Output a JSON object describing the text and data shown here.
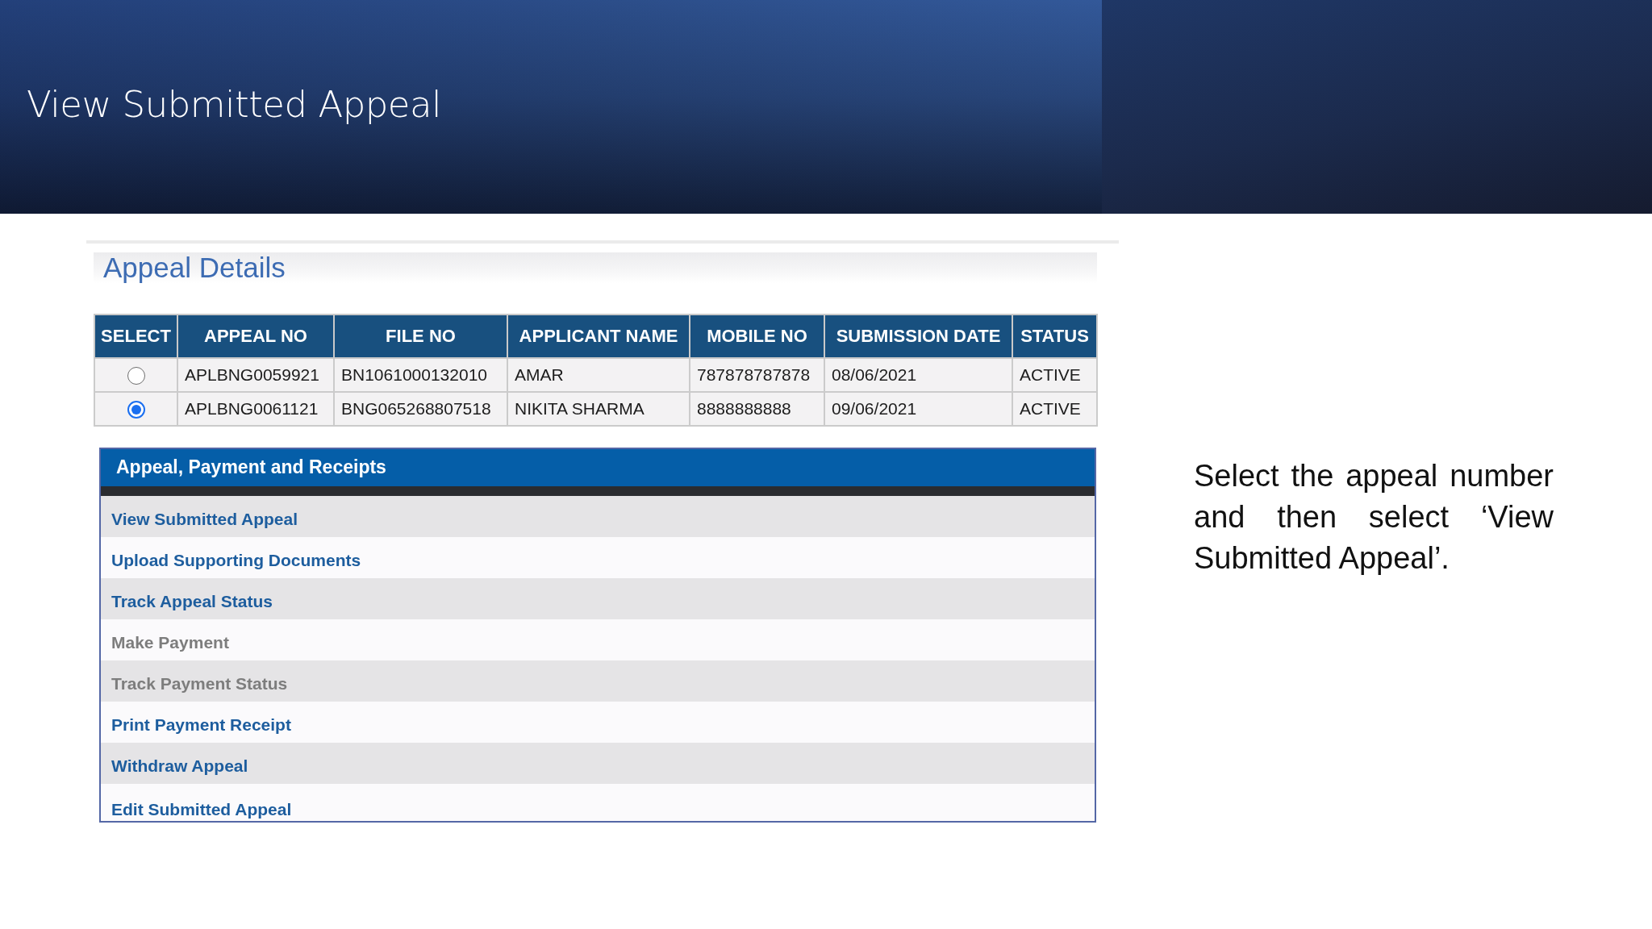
{
  "slide": {
    "title": "View Submitted Appeal",
    "note": "Select the appeal number and then select ‘View Submitted Appeal’."
  },
  "appeal_details": {
    "title": "Appeal Details",
    "table": {
      "columns": [
        "SELECT",
        "APPEAL NO",
        "FILE NO",
        "APPLICANT NAME",
        "MOBILE NO",
        "SUBMISSION DATE",
        "STATUS"
      ],
      "rows": [
        {
          "selected": false,
          "cells": [
            "",
            "APLBNG0059921",
            "BN1061000132010",
            "AMAR",
            "787878787878",
            "08/06/2021",
            "ACTIVE"
          ]
        },
        {
          "selected": true,
          "cells": [
            "",
            "APLBNG0061121",
            "BNG065268807518",
            "NIKITA SHARMA",
            "8888888888",
            "09/06/2021",
            "ACTIVE"
          ]
        }
      ]
    }
  },
  "menu": {
    "title": "Appeal, Payment and Receipts",
    "items": [
      {
        "label": "View Submitted Appeal",
        "disabled": false
      },
      {
        "label": "Upload Supporting Documents",
        "disabled": false
      },
      {
        "label": "Track Appeal Status",
        "disabled": false
      },
      {
        "label": "Make Payment",
        "disabled": true
      },
      {
        "label": "Track Payment Status",
        "disabled": true
      },
      {
        "label": "Print Payment Receipt",
        "disabled": false
      },
      {
        "label": "Withdraw Appeal",
        "disabled": false
      },
      {
        "label": "Edit Submitted Appeal",
        "disabled": false
      }
    ]
  }
}
